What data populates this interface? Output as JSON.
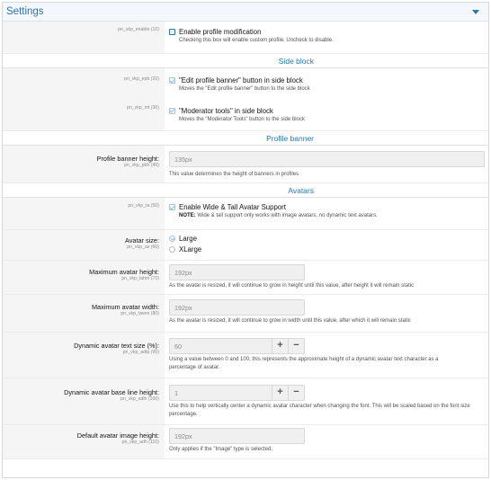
{
  "header": {
    "title": "Settings"
  },
  "enable_profile": {
    "key": "pn_vkp_enable (10)",
    "option": "Enable profile modification",
    "hint": "Checking this box will enable custom profile. Uncheck to disable."
  },
  "sections": {
    "side_block": "Side block",
    "profile_banner": "Profile banner",
    "avatars": "Avatars"
  },
  "epb": {
    "key": "pn_vkp_epb (20)",
    "option": "\"Edit profile banner\" button in side block",
    "hint": "Moves the \"Edit profile banner\" button to the side block"
  },
  "mt": {
    "key": "pn_vkp_mt (30)",
    "option": "\"Moderator tools\" in side block",
    "hint": "Moves the \"Moderator Tools\" button to the side block"
  },
  "pbh": {
    "label": "Profile banner height:",
    "key": "pn_vkp_pbh (40)",
    "value": "135px",
    "hint": "This value determines the height of banners in profiles"
  },
  "ta": {
    "key": "pn_vkp_ta (50)",
    "option": "Enable Wide & Tall Avatar Support",
    "note_label": "NOTE:",
    "note_text": " Wide & tall support only works with image avatars, no dynamic text avatars."
  },
  "as": {
    "label": "Avatar size:",
    "key": "pn_vkp_as (60)",
    "options": [
      "Large",
      "XLarge"
    ]
  },
  "tahm": {
    "label": "Maximum avatar height:",
    "key": "pn_vkp_tahm (70)",
    "value": "192px",
    "hint": "As the avatar is resized, it will continue to grow in height until this value, after height it will remain static"
  },
  "tawm": {
    "label": "Maximum avatar width:",
    "key": "pn_vkp_tawm (80)",
    "value": "192px",
    "hint": "As the avatar is resized, it will continue to grow in width until this value, after which it will remain static"
  },
  "adtp": {
    "label": "Dynamic avatar text size (%):",
    "key": "pn_vkp_adtp (90)",
    "value": "60",
    "plus": "+",
    "minus": "−",
    "hint": "Using a value between 0 and 100, this represents the approximate height of a dynamic avatar text character as a percentage of avatar."
  },
  "adlh": {
    "label": "Dynamic avatar base line height:",
    "key": "pn_vkp_adlh (100)",
    "value": "1",
    "plus": "+",
    "minus": "−",
    "hint": "Use this to help vertically center a dynamic avatar character when changing the font. This will be scaled based on the font size percentage."
  },
  "adh": {
    "label": "Default avatar image height:",
    "key": "pn_vkp_adh (110)",
    "value": "192px",
    "hint": "Only applies if the \"Image\" type is selected."
  },
  "colors": {
    "accent": "#2577b1",
    "header_bg": "#f4f7fb",
    "label_bg": "#f5f5f5"
  }
}
